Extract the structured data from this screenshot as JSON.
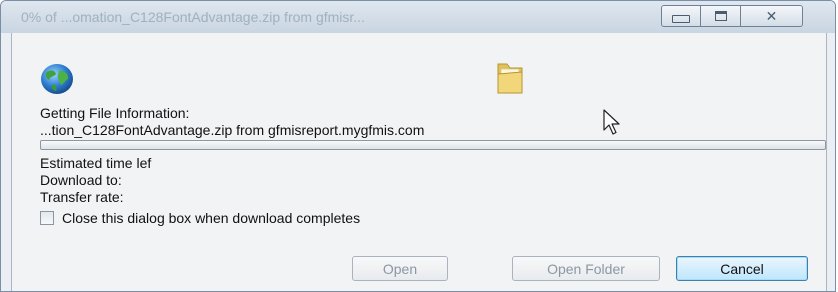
{
  "window": {
    "title": "0% of ...omation_C128FontAdvantage.zip from gfmisr...",
    "controls": {
      "minimize": "",
      "maximize": "",
      "close_glyph": "✕"
    }
  },
  "dialog": {
    "status": "Getting File Information:",
    "file_line": "...tion_C128FontAdvantage.zip from gfmisreport.mygfmis.com",
    "progress_fraction": 0.0,
    "estimated_time_label": "Estimated time lef",
    "download_to_label": "Download to:",
    "transfer_rate_label": "Transfer rate:",
    "close_checkbox_label": "Close this dialog box when download completes",
    "close_checkbox_checked": false
  },
  "buttons": {
    "open": "Open",
    "open_folder": "Open Folder",
    "cancel": "Cancel"
  },
  "icons": {
    "globe": "globe-icon",
    "folder": "folder-icon",
    "cursor": "mouse-cursor-icon"
  }
}
